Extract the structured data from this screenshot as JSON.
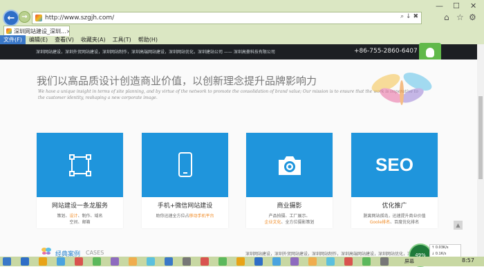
{
  "browser": {
    "back_icon": "back-arrow-icon",
    "forward_icon": "forward-arrow-icon",
    "url": "http://www.szgjh.com/",
    "address_controls": "⌕ ↓ ✖",
    "tab_title": "深圳网站建设_深圳...",
    "tab_close": "×",
    "window_controls": [
      "—",
      "☐",
      "✕"
    ],
    "tool_icons": [
      "⌂",
      "☆",
      "⚙"
    ],
    "menu": [
      "文件(F)",
      "编辑(E)",
      "查看(V)",
      "收藏夹(A)",
      "工具(T)",
      "帮助(H)"
    ],
    "accent": "#3a78c8"
  },
  "site": {
    "nav_text": "深圳网站建设，深圳外贸网站建设，深圳网站制作，深圳高端网站建设，深圳网站优化，深圳建站公司 —— 深圳高豪科技有限公司",
    "phone": "+86-755-2860-6407",
    "slogan_title": "我们以高品质设计创造商业价值，以创新理念提升品牌影响力",
    "slogan_en": "We have a unique insight in terms of site planning, and by virtue of the network to promote the consolidation of brand value; Our mission is to ensure that the work is imperative to the customer identity, reshaping a new corporate image.",
    "services": [
      {
        "title": "网站建设一条龙服务",
        "desc1_a": "策划、",
        "desc1_hl": "设计",
        "desc1_b": "、制作、域名",
        "desc2_a": "空间、邮箱",
        "desc2_hl": "",
        "desc2_b": "",
        "icon": "frame-select-icon"
      },
      {
        "title": "手机+微信网站建设",
        "desc1_a": "助你迅速全方位占",
        "desc1_hl": "移动手机平台",
        "desc1_b": "",
        "desc2_a": "",
        "desc2_hl": "",
        "desc2_b": "",
        "icon": "mobile-phone-icon"
      },
      {
        "title": "商业摄影",
        "desc1_a": "产品拍摄、工厂展示、",
        "desc1_hl": "",
        "desc1_b": "",
        "desc2_a": "",
        "desc2_hl": "企业文化",
        "desc2_b": "、全方位摄影策划",
        "icon": "camera-icon"
      },
      {
        "title": "优化推广",
        "desc1_a": "脱离网站孤岛，迅速提升商业价值",
        "desc1_hl": "",
        "desc1_b": "",
        "desc2_a": "",
        "desc2_hl": "Goole排名",
        "desc2_b": "、百度优化排名",
        "icon": "seo-text-icon"
      }
    ],
    "seo_label": "SEO",
    "cases_title_cn": "经典案例",
    "cases_title_en": "CASES",
    "footer_links": "深圳网站建设，深圳外贸网站建设，深圳网站制作，深圳高端网站建设，深圳网站优化，深圳",
    "to_top": "▲",
    "card_color": "#1f95dc",
    "highlight_color": "#f08a24"
  },
  "system": {
    "net_percent": "49%",
    "net_up": "↑ 0.03K/s",
    "net_down": "↓ 0.1K/s",
    "tray_text": "屏幕",
    "clock": "8:57"
  }
}
